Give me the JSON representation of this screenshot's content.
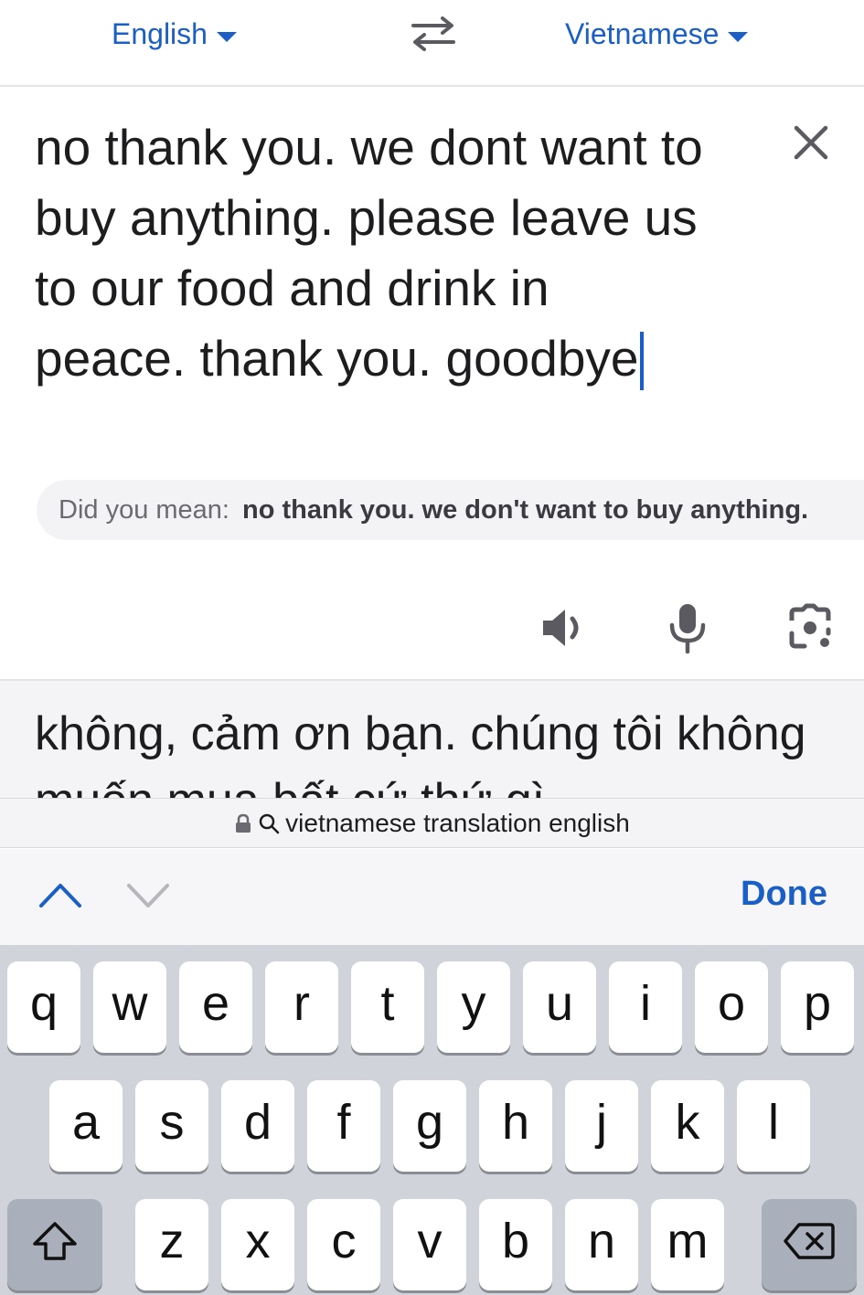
{
  "header": {
    "source_language": "English",
    "target_language": "Vietnamese"
  },
  "source": {
    "text": "no thank you. we dont want to buy anything. please leave us to our food and drink in peace. thank you. goodbye"
  },
  "suggestion": {
    "label": "Did you mean:",
    "text": "no thank you. we don't want to buy anything."
  },
  "translation": {
    "text": "không, cảm ơn bạn. chúng tôi không muốn mua bất cứ thứ gì"
  },
  "url_bar": {
    "text": "vietnamese translation english"
  },
  "accessory": {
    "done_label": "Done"
  },
  "keyboard": {
    "row1": [
      "q",
      "w",
      "e",
      "r",
      "t",
      "y",
      "u",
      "i",
      "o",
      "p"
    ],
    "row2": [
      "a",
      "s",
      "d",
      "f",
      "g",
      "h",
      "j",
      "k",
      "l"
    ],
    "row3": [
      "z",
      "x",
      "c",
      "v",
      "b",
      "n",
      "m"
    ]
  },
  "icons": {
    "swap": "swap-arrows-icon",
    "clear": "close-icon",
    "speaker": "speaker-icon",
    "mic": "microphone-icon",
    "camera": "camera-lens-icon",
    "lock": "lock-icon",
    "search": "search-icon",
    "shift": "shift-icon",
    "backspace": "backspace-icon"
  },
  "colors": {
    "accent": "#1a5fc5",
    "keyboard_bg": "#d0d3da",
    "special_key": "#aab0bb"
  }
}
